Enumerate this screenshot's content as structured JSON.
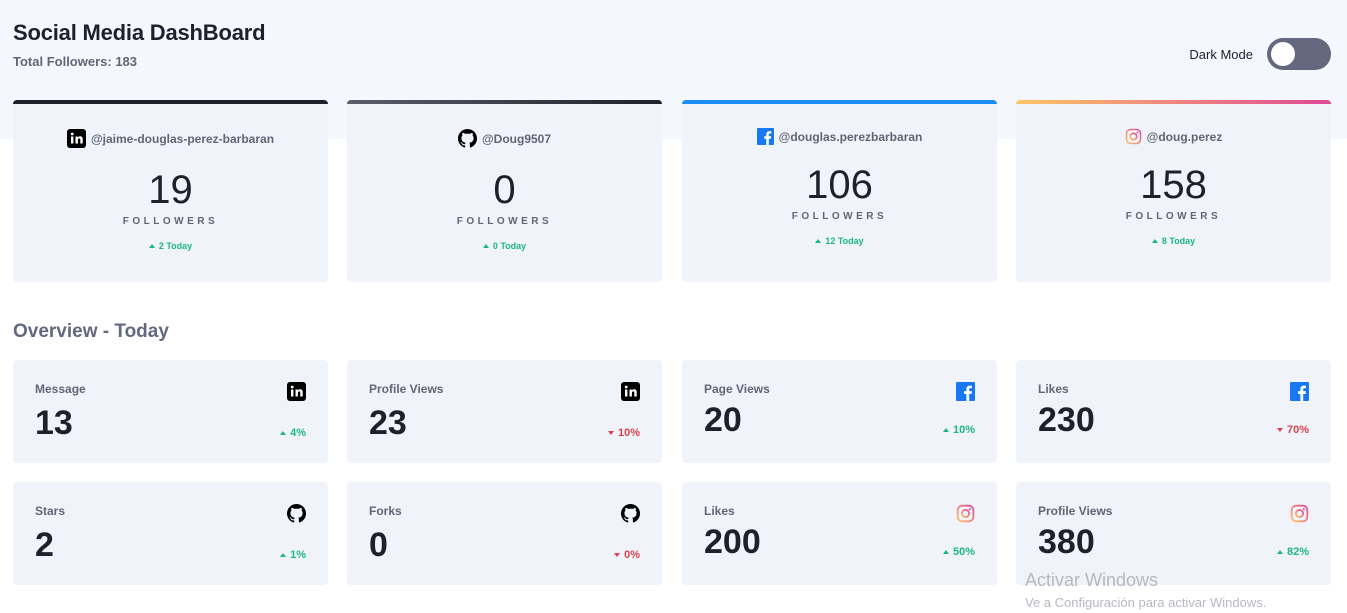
{
  "header": {
    "title": "Social Media DashBoard",
    "total_followers": "Total Followers: 183",
    "dark_mode_label": "Dark Mode"
  },
  "cards": [
    {
      "network": "linkedin",
      "handle": "@jaime-douglas-perez-barbaran",
      "count": "19",
      "label": "FOLLOWERS",
      "today": "2 Today",
      "bar_color": "#1e202a"
    },
    {
      "network": "github",
      "handle": "@Doug9507",
      "count": "0",
      "label": "FOLLOWERS",
      "today": "0 Today",
      "bar_color": "#1e202a"
    },
    {
      "network": "facebook",
      "handle": "@douglas.perezbarbaran",
      "count": "106",
      "label": "FOLLOWERS",
      "today": "12 Today",
      "bar_color": "#198ff5"
    },
    {
      "network": "instagram",
      "handle": "@doug.perez",
      "count": "158",
      "label": "FOLLOWERS",
      "today": "8 Today",
      "bar_color": "#fdc468"
    }
  ],
  "overview": {
    "title": "Overview - Today",
    "items": [
      {
        "label": "Message",
        "value": "13",
        "change": "4%",
        "direction": "up",
        "icon": "linkedin-icon"
      },
      {
        "label": "Profile Views",
        "value": "23",
        "change": "10%",
        "direction": "down",
        "icon": "linkedin-icon"
      },
      {
        "label": "Page Views",
        "value": "20",
        "change": "10%",
        "direction": "up",
        "icon": "facebook-icon"
      },
      {
        "label": "Likes",
        "value": "230",
        "change": "70%",
        "direction": "down",
        "icon": "facebook-icon"
      },
      {
        "label": "Stars",
        "value": "2",
        "change": "1%",
        "direction": "up",
        "icon": "github-icon"
      },
      {
        "label": "Forks",
        "value": "0",
        "change": "0%",
        "direction": "down",
        "icon": "github-icon"
      },
      {
        "label": "Likes",
        "value": "200",
        "change": "50%",
        "direction": "up",
        "icon": "instagram-icon"
      },
      {
        "label": "Profile Views",
        "value": "380",
        "change": "82%",
        "direction": "up",
        "icon": "instagram-icon"
      }
    ]
  },
  "watermark": {
    "line1": "Activar Windows",
    "line2": "Ve a Configuración para activar Windows."
  },
  "colors": {
    "up": "#1eb589",
    "down": "#dc414c",
    "toggle_bg": "#63687e"
  }
}
